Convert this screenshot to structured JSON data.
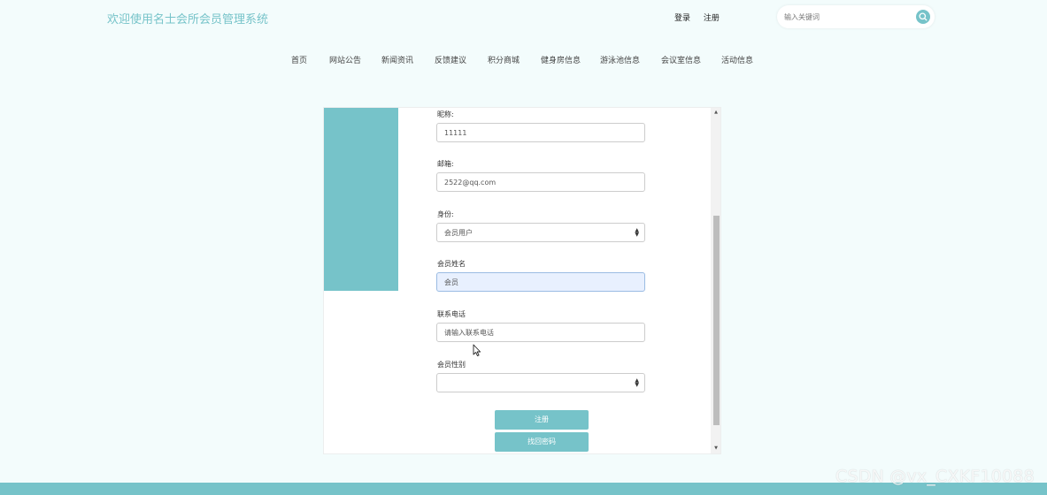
{
  "header": {
    "title": "欢迎使用名士会所会员管理系统",
    "login_label": "登录",
    "register_label": "注册",
    "search_placeholder": "输入关键词"
  },
  "nav": {
    "items": [
      "首页",
      "网站公告",
      "新闻资讯",
      "反馈建议",
      "积分商城",
      "健身房信息",
      "游泳池信息",
      "会议室信息",
      "活动信息"
    ]
  },
  "form": {
    "nickname": {
      "label": "昵称:",
      "value": "11111"
    },
    "email": {
      "label": "邮箱:",
      "value": "2522@qq.com"
    },
    "identity": {
      "label": "身份:",
      "value": "会员用户"
    },
    "member_name": {
      "label": "会员姓名",
      "value": "会员"
    },
    "phone": {
      "label": "联系电话",
      "placeholder": "请输入联系电话"
    },
    "gender": {
      "label": "会员性别",
      "value": ""
    },
    "register_button": "注册",
    "recover_button": "找回密码"
  },
  "watermark": "CSDN @vx_CXKF10088",
  "colors": {
    "accent": "#76c3c9",
    "background": "#f3fcfc"
  }
}
